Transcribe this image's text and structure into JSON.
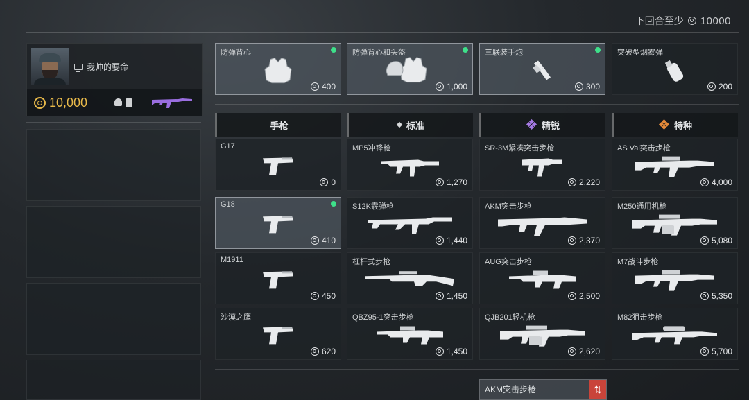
{
  "header": {
    "next_round_label": "下回合至少",
    "next_round_amount": "10000"
  },
  "player": {
    "name": "我帅的要命",
    "money": "10,000"
  },
  "equipment": [
    {
      "name": "防弹背心",
      "price": "400",
      "owned": true,
      "icon": "vest-icon"
    },
    {
      "name": "防弹背心和头盔",
      "price": "1,000",
      "owned": true,
      "icon": "vest-helmet-icon"
    },
    {
      "name": "三联装手炮",
      "price": "300",
      "owned": true,
      "icon": "hand-cannon-icon"
    },
    {
      "name": "突破型烟雾弹",
      "price": "200",
      "owned": false,
      "icon": "smoke-grenade-icon"
    }
  ],
  "columns": [
    {
      "label": "手枪",
      "icon": ""
    },
    {
      "label": "标准",
      "icon": "diamond-icon"
    },
    {
      "label": "精锐",
      "icon": "elite-icon",
      "color": "#a77be6"
    },
    {
      "label": "特种",
      "icon": "special-icon",
      "color": "#e58a3a"
    }
  ],
  "weapons": [
    [
      {
        "name": "G17",
        "price": "0",
        "owned": false,
        "type": "pistol"
      },
      {
        "name": "G18",
        "price": "410",
        "owned": true,
        "type": "pistol"
      },
      {
        "name": "M1911",
        "price": "450",
        "owned": false,
        "type": "pistol"
      },
      {
        "name": "沙漠之鹰",
        "price": "620",
        "owned": false,
        "type": "pistol"
      }
    ],
    [
      {
        "name": "MP5冲锋枪",
        "price": "1,270",
        "owned": false,
        "type": "smg"
      },
      {
        "name": "S12K霰弹枪",
        "price": "1,440",
        "owned": false,
        "type": "shotgun"
      },
      {
        "name": "杠杆式步枪",
        "price": "1,450",
        "owned": false,
        "type": "lever"
      },
      {
        "name": "QBZ95-1突击步枪",
        "price": "1,450",
        "owned": false,
        "type": "bullpup"
      }
    ],
    [
      {
        "name": "SR-3M紧凑突击步枪",
        "price": "2,220",
        "owned": false,
        "type": "compact"
      },
      {
        "name": "AKM突击步枪",
        "price": "2,370",
        "owned": false,
        "type": "ak"
      },
      {
        "name": "AUG突击步枪",
        "price": "2,500",
        "owned": false,
        "type": "bullpup"
      },
      {
        "name": "QJB201轻机枪",
        "price": "2,620",
        "owned": false,
        "type": "lmg"
      }
    ],
    [
      {
        "name": "AS Val突击步枪",
        "price": "4,000",
        "owned": false,
        "type": "rifle"
      },
      {
        "name": "M250通用机枪",
        "price": "5,080",
        "owned": false,
        "type": "lmg"
      },
      {
        "name": "M7战斗步枪",
        "price": "5,350",
        "owned": false,
        "type": "rifle"
      },
      {
        "name": "M82狙击步枪",
        "price": "5,700",
        "owned": false,
        "type": "sniper"
      }
    ]
  ],
  "bottom_slot": {
    "name": "AKM突击步枪",
    "swap_icon": "swap-icon"
  },
  "colors": {
    "gold": "#e8b94a",
    "owned_dot": "#3ee08a",
    "elite": "#a77be6",
    "special": "#e58a3a",
    "swap": "#c9443a"
  }
}
